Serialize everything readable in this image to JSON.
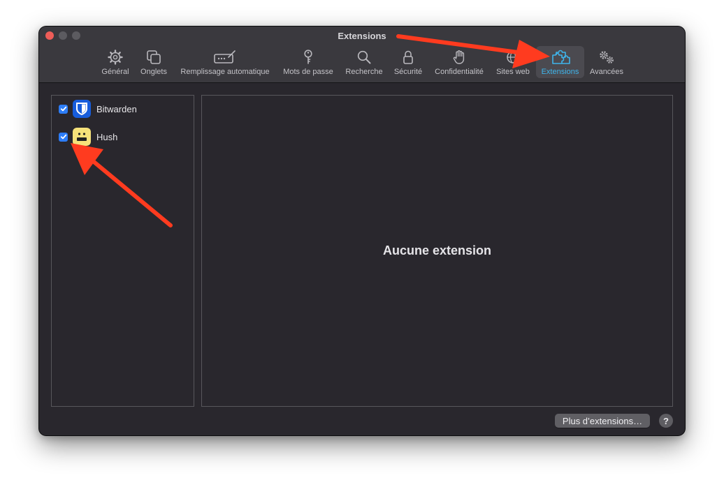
{
  "window": {
    "title": "Extensions"
  },
  "toolbar": {
    "items": [
      {
        "label": "Général",
        "icon": "gear-icon"
      },
      {
        "label": "Onglets",
        "icon": "tabs-icon"
      },
      {
        "label": "Remplissage automatique",
        "icon": "autofill-icon"
      },
      {
        "label": "Mots de passe",
        "icon": "key-icon"
      },
      {
        "label": "Recherche",
        "icon": "search-icon"
      },
      {
        "label": "Sécurité",
        "icon": "lock-icon"
      },
      {
        "label": "Confidentialité",
        "icon": "hand-icon"
      },
      {
        "label": "Sites web",
        "icon": "globe-icon"
      },
      {
        "label": "Extensions",
        "icon": "puzzle-icon",
        "active": true
      },
      {
        "label": "Avancées",
        "icon": "gears-icon"
      }
    ]
  },
  "extensions": [
    {
      "name": "Bitwarden",
      "enabled": true,
      "icon": "bitwarden-shield-icon"
    },
    {
      "name": "Hush",
      "enabled": true,
      "icon": "hush-face-icon"
    }
  ],
  "detail": {
    "empty_message": "Aucune extension"
  },
  "footer": {
    "more_button": "Plus d’extensions…",
    "help_button": "?"
  },
  "colors": {
    "accent": "#3fb5ec",
    "checkbox": "#2d7df7",
    "arrow": "#ff3b1f",
    "window_bg": "#29272d"
  }
}
